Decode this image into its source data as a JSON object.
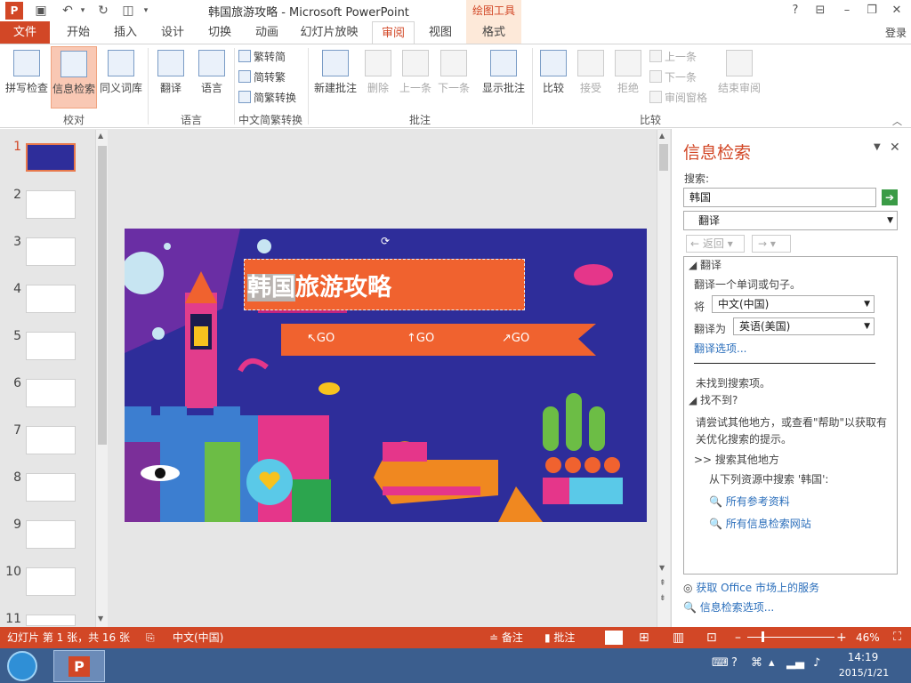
{
  "app": {
    "icon_letter": "P",
    "window_title": "韩国旅游攻略 - Microsoft PowerPoint",
    "contextual_tab_group": "绘图工具",
    "help": "?",
    "login": "登录"
  },
  "tabs": [
    {
      "label": "文件"
    },
    {
      "label": "开始"
    },
    {
      "label": "插入"
    },
    {
      "label": "设计"
    },
    {
      "label": "切换"
    },
    {
      "label": "动画"
    },
    {
      "label": "幻灯片放映"
    },
    {
      "label": "审阅"
    },
    {
      "label": "视图"
    },
    {
      "label": "格式"
    }
  ],
  "ribbon": {
    "groups": [
      {
        "label": "校对"
      },
      {
        "label": "语言"
      },
      {
        "label": "中文简繁转换"
      },
      {
        "label": "批注"
      },
      {
        "label": "比较"
      }
    ],
    "buttons": {
      "spellcheck": "拼写检查",
      "research": "信息检索",
      "thesaurus": "同义词库",
      "translate": "翻译",
      "language": "语言",
      "to_simplified": "繁转简",
      "to_traditional": "简转繁",
      "conversion": "简繁转换",
      "new_comment": "新建批注",
      "delete": "删除",
      "prev": "上一条",
      "next": "下一条",
      "show_comments": "显示批注",
      "compare": "比较",
      "accept": "接受",
      "reject": "拒绝",
      "prev_change": "上一条",
      "next_change": "下一条",
      "reviewing_pane": "审阅窗格",
      "end_review": "结束审阅"
    }
  },
  "slides": {
    "numbers": [
      "1",
      "2",
      "3",
      "4",
      "5",
      "6",
      "7",
      "8",
      "9",
      "10",
      "11"
    ],
    "current": 1
  },
  "slide": {
    "title_highlight": "韩国",
    "title_rest": "旅游攻略",
    "go_labels": [
      "↖GO",
      "↑GO",
      "↗GO"
    ]
  },
  "research_pane": {
    "title": "信息检索",
    "search_label": "搜索:",
    "search_value": "韩国",
    "service_value": "翻译",
    "back_label": "返回",
    "section_translate": "翻译",
    "translate_desc": "翻译一个单词或句子。",
    "from_label": "将",
    "from_value": "中文(中国)",
    "to_label": "翻译为",
    "to_value": "英语(美国)",
    "translate_options": "翻译选项...",
    "not_found": "未找到搜索项。",
    "cant_find": "找不到?",
    "suggestion": "请尝试其他地方，或查看\"帮助\"以获取有关优化搜索的提示。",
    "search_other": ">> 搜索其他地方",
    "search_from": "从下列资源中搜索 '韩国':",
    "all_reference": "所有参考资料",
    "all_sites": "所有信息检索网站",
    "get_services": "获取 Office 市场上的服务",
    "research_options": "信息检索选项..."
  },
  "statusbar": {
    "slide_info": "幻灯片 第 1 张，共 16 张",
    "language": "中文(中国)",
    "notes": "备注",
    "comments": "批注",
    "zoom": "46%"
  },
  "taskbar": {
    "time": "14:19",
    "date": "2015/1/21"
  },
  "colors": {
    "accent": "#d24726",
    "slide_bg": "#2e2d9a"
  }
}
